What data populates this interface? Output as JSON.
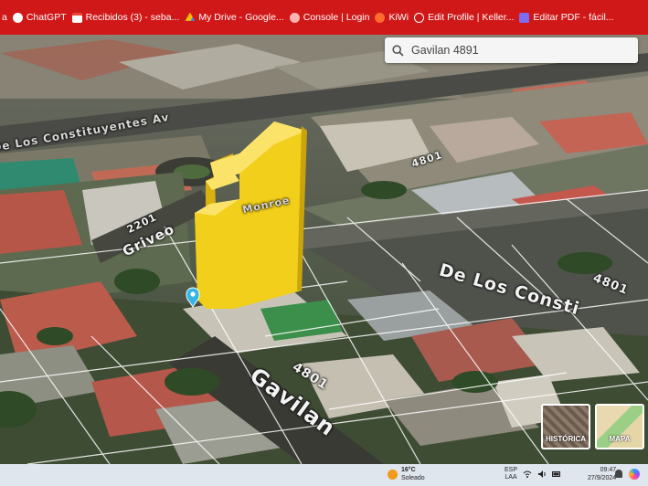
{
  "bookmarks": [
    {
      "label": "a",
      "color": "#ffffff"
    },
    {
      "label": "ChatGPT",
      "color": "#ffffff"
    },
    {
      "label": "Recibidos (3) - seba...",
      "color": "#ea4335"
    },
    {
      "label": "My Drive - Google...",
      "color": "#fbbc04"
    },
    {
      "label": "Console | Login",
      "color": "#ff5a5a"
    },
    {
      "label": "KiWi",
      "color": "#ff6b2d"
    },
    {
      "label": "Edit Profile | Keller...",
      "color": "#ffffff"
    },
    {
      "label": "Editar PDF - fácil...",
      "color": "#7e6cf0"
    }
  ],
  "search": {
    "value": "Gavilan 4891",
    "icon": "search-icon"
  },
  "map": {
    "labels": {
      "gavilan": "Gavilan",
      "gavilan_num": "4801",
      "de_los": "De Los Consti",
      "de_los_num": "4801",
      "grive": "Griveo",
      "grive_num": "2201",
      "consti_top": "De Los Constituyentes Av",
      "num_4801_top": "4801",
      "monroe": "Monroe"
    },
    "building_color": "#f2cf1a",
    "pin_icon": "location-pin-icon"
  },
  "layers": {
    "historic": "HISTÓRICA",
    "map": "MAPA"
  },
  "taskbar": {
    "temp": "16°C",
    "weather": "Soleado",
    "lang_top": "ESP",
    "lang_bottom": "LAA",
    "time": "09:47",
    "date": "27/9/2024"
  }
}
